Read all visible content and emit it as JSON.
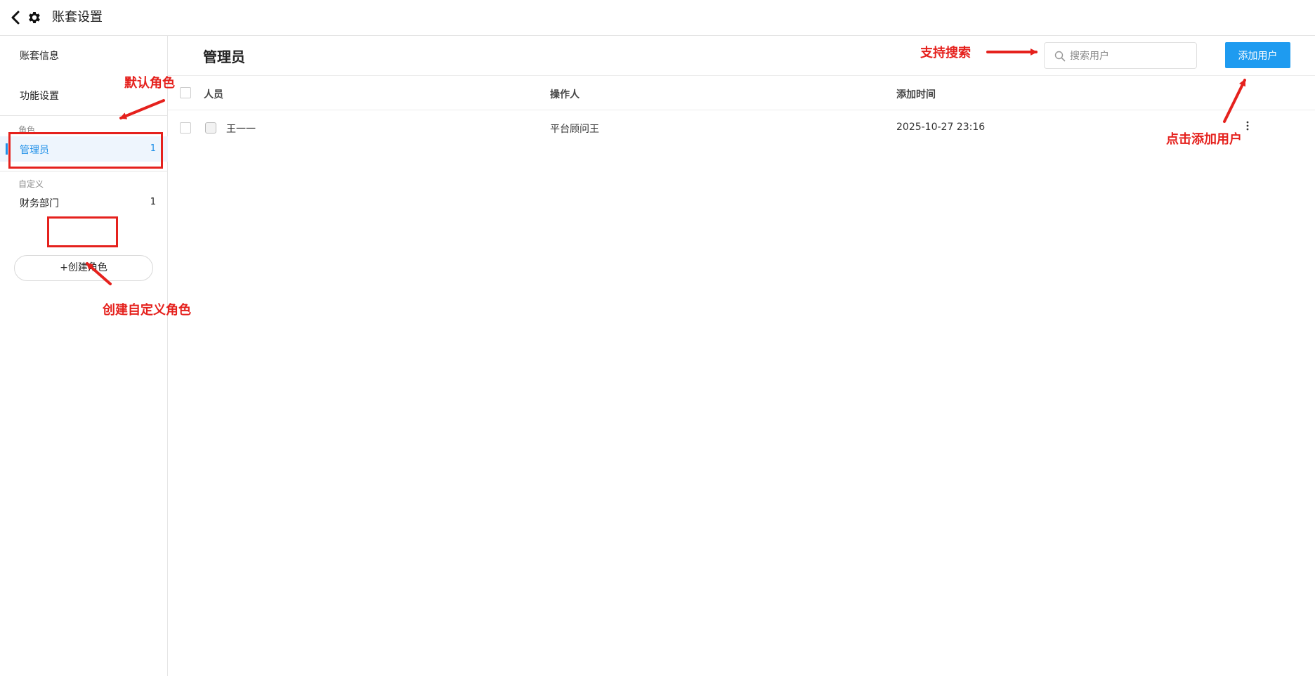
{
  "header": {
    "title": "账套设置",
    "back_icon": "chevron-left-icon",
    "settings_icon": "gear-icon"
  },
  "sidebar": {
    "links": [
      {
        "label": "账套信息"
      },
      {
        "label": "功能设置"
      }
    ],
    "roles_section": {
      "title": "角色",
      "items": [
        {
          "label": "管理员",
          "count": "1",
          "active": true
        }
      ]
    },
    "custom_section": {
      "title": "自定义",
      "items": [
        {
          "label": "财务部门",
          "count": "1",
          "active": false
        }
      ]
    },
    "create_role_label": "创建角色"
  },
  "main": {
    "title": "管理员",
    "search": {
      "placeholder": "搜索用户",
      "value": ""
    },
    "add_user_label": "添加用户",
    "table": {
      "columns": [
        "人员",
        "操作人",
        "添加时间"
      ],
      "rows": [
        {
          "person": "王一一",
          "operator": "平台顾问王",
          "added_time": "2025-10-27 23:16"
        }
      ]
    }
  },
  "annotations": {
    "default_role": "默认角色",
    "support_search": "支持搜索",
    "click_add_user": "点击添加用户",
    "create_custom_role": "创建自定义角色",
    "color": "#e5211d"
  },
  "colors": {
    "accent": "#1e9bf0",
    "active_text": "#1e8fe8",
    "active_bg": "#eef5fd",
    "annotation_red": "#e5211d"
  }
}
